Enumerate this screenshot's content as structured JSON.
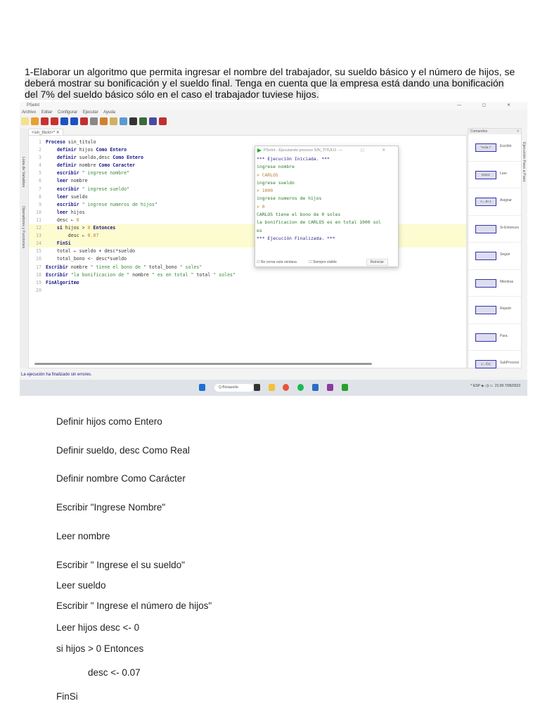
{
  "question": {
    "lines": [
      "1-Elaborar un algoritmo que permita ingresar el nombre del trabajador, su sueldo básico y el número de hijos, se",
      "deberá mostrar su bonificación y el sueldo final. Tenga en cuenta que la empresa está dando una bonificación",
      "del 7% del sueldo básico sólo en el caso el trabajador tuviese hijos."
    ]
  },
  "app": {
    "title": "PSeInt",
    "window_controls": "— ▢ ✕",
    "menu": [
      "Archivo",
      "Editar",
      "Configurar",
      "Ejecutar",
      "Ayuda"
    ],
    "toolbar_icons": [
      "new-icon",
      "open-icon",
      "save-icon",
      "save-as-icon",
      "undo-icon",
      "redo-icon",
      "cut-icon",
      "copy-icon",
      "paste-icon",
      "indent-icon",
      "search-icon",
      "run-icon",
      "step-icon",
      "flowchart-icon",
      "help-icon"
    ],
    "tab": "<sin_titulo>*  ✕",
    "left_panel": [
      "Lista de Variables",
      "Operadores y Funciones"
    ],
    "right_strip": "Ejecución Paso a Paso",
    "code": [
      [
        [
          "kw",
          "Proceso "
        ],
        [
          "id",
          "sin_titulo"
        ]
      ],
      [
        [
          "kw",
          "    definir "
        ],
        [
          "id",
          "hijos "
        ],
        [
          "kw",
          "Como Entero"
        ]
      ],
      [
        [
          "kw",
          "    definir "
        ],
        [
          "id",
          "sueldo,desc "
        ],
        [
          "kw",
          "Como Entero"
        ]
      ],
      [
        [
          "kw",
          "    definir "
        ],
        [
          "id",
          "nombre "
        ],
        [
          "kw",
          "Como Caracter"
        ]
      ],
      [
        [
          "kw",
          "    escribir "
        ],
        [
          "st",
          "\" ingrese nombre\""
        ]
      ],
      [
        [
          "kw",
          "    leer "
        ],
        [
          "id",
          "nombre"
        ]
      ],
      [
        [
          "kw",
          "    escribir "
        ],
        [
          "st",
          "\" ingrese sueldo\""
        ]
      ],
      [
        [
          "kw",
          "    leer "
        ],
        [
          "id",
          "sueldo"
        ]
      ],
      [
        [
          "kw",
          "    escribir "
        ],
        [
          "st",
          "\" ingrese numeros de hijos\""
        ]
      ],
      [
        [
          "kw",
          "    leer "
        ],
        [
          "id",
          "hijos"
        ]
      ],
      [
        [
          "id",
          "    desc ← "
        ],
        [
          "nm",
          "0"
        ]
      ],
      [
        [
          "kw",
          "    si "
        ],
        [
          "id",
          "hijos > "
        ],
        [
          "nm",
          "0 "
        ],
        [
          "kw",
          "Entonces"
        ]
      ],
      [
        [
          "id",
          "        desc ← "
        ],
        [
          "nm",
          "0.07"
        ]
      ],
      [
        [
          "kw",
          "    FinSi"
        ]
      ],
      [
        [
          "id",
          "    total ← sueldo + desc*sueldo"
        ]
      ],
      [
        [
          "id",
          "    total_bono <- desc*sueldo"
        ]
      ],
      [
        [
          "kw",
          "Escribir "
        ],
        [
          "id",
          "nombre "
        ],
        [
          "st",
          "\" tiene el bono de \""
        ],
        [
          "id",
          " total_bono "
        ],
        [
          "st",
          "\" soles\""
        ]
      ],
      [
        [
          "kw",
          "Escribir "
        ],
        [
          "st",
          "\"la bonificacion de \""
        ],
        [
          "id",
          " nombre "
        ],
        [
          "st",
          "\" es en total \""
        ],
        [
          "id",
          " total "
        ],
        [
          "st",
          "\" soles\""
        ]
      ],
      [
        [
          "kw",
          "FinAlgoritmo"
        ]
      ],
      [
        [
          "id",
          ""
        ]
      ]
    ],
    "highlighted_lines": [
      12,
      13,
      14
    ],
    "run_dialog": {
      "title": "PSeInt - Ejecutando proceso SIN_TITULO",
      "controls": "— ▢ ✕",
      "output": [
        [
          "sys",
          "*** Ejecución Iniciada. ***"
        ],
        [
          "pr",
          " ingrese nombre"
        ],
        [
          "in",
          "> CARLOS"
        ],
        [
          "pr",
          " ingrese sueldo"
        ],
        [
          "in",
          "> 1000"
        ],
        [
          "pr",
          " ingrese numeros de hijos"
        ],
        [
          "in",
          "> 0"
        ],
        [
          "res",
          "CARLOS tiene el bono de 0 soles"
        ],
        [
          "res",
          "la bonificacion de CARLOS es en total 1000 sol"
        ],
        [
          "res",
          "es"
        ],
        [
          "sys",
          "*** Ejecución Finalizada. ***"
        ]
      ],
      "checkbox_close": "No cerrar esta ventana",
      "checkbox_visible": "Siempre visible",
      "restart": "Reiniciar"
    },
    "commands": {
      "header": "Comandos",
      "close": "×",
      "items": [
        "Escribir",
        "Leer",
        "Asignar",
        "Si-Entonces",
        "Según",
        "Mientras",
        "Repetir",
        "Para",
        "SubProceso"
      ],
      "icon_labels": [
        "\"Hola !\"",
        "Dato1",
        "A←B+1",
        "",
        "",
        "",
        "",
        "",
        "y←f(x)"
      ]
    },
    "status": "La ejecución ha finalizado sin errores.",
    "taskbar": {
      "search": "Q Búsqueda",
      "tray": "^  ESP   ◈ ◁) ▭",
      "time": "21:00",
      "date": "7/05/2023"
    }
  },
  "answer": [
    "Definir hijos como Entero",
    "Definir sueldo, desc Como Real",
    "Definir nombre Como Carácter",
    "Escribir \"Ingrese Nombre\"",
    "Leer nombre",
    "Escribir \" Ingrese el su sueldo\"",
    "Leer sueldo",
    "Escribir \" Ingrese el número de hijos\"",
    "Leer hijos desc <- 0",
    "si hijos > 0 Entonces",
    "desc <- 0.07",
    "FinSi"
  ]
}
